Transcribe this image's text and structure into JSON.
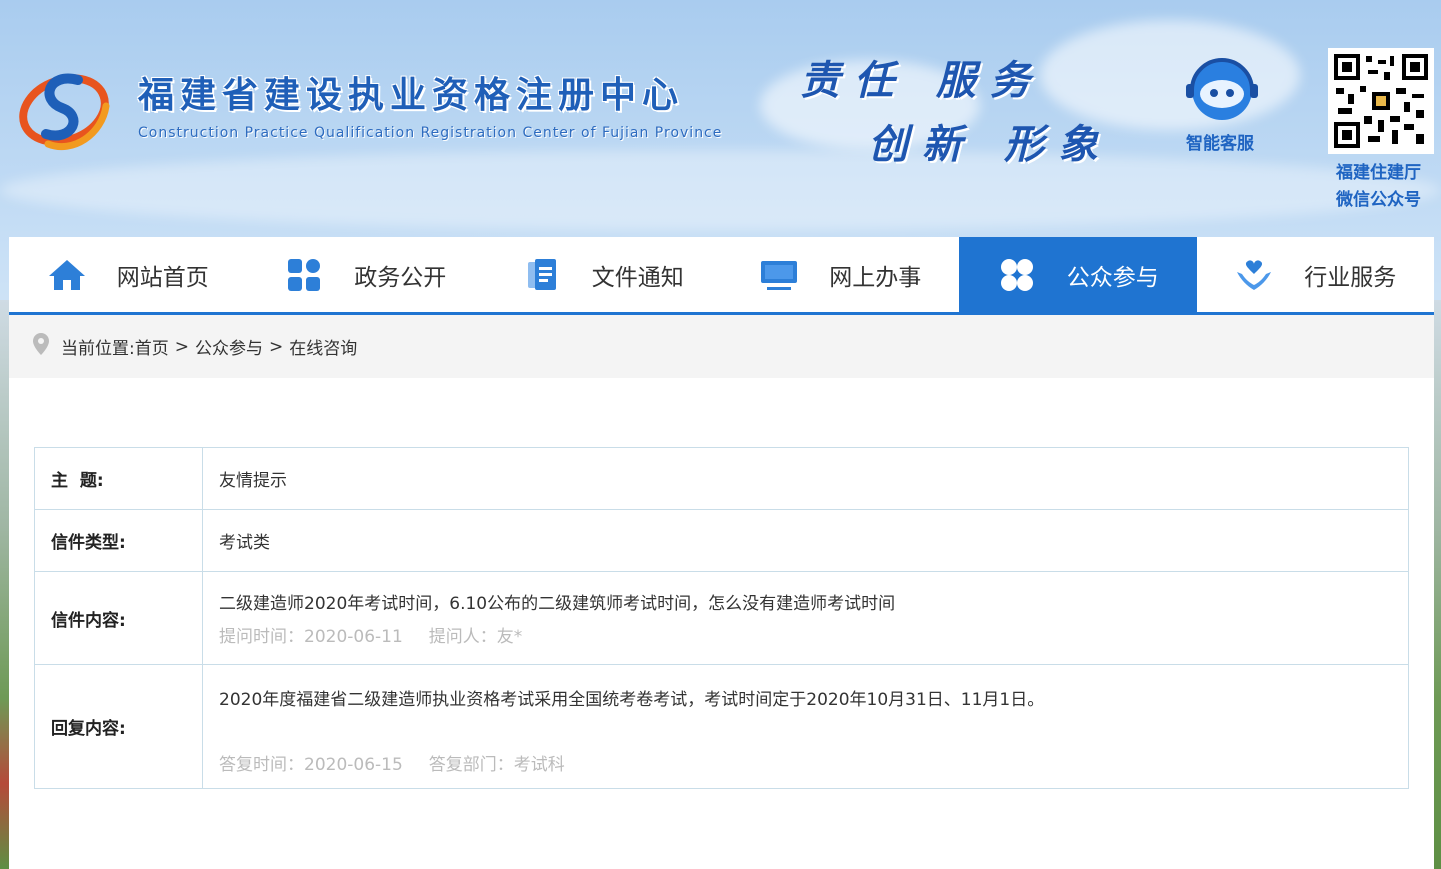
{
  "header": {
    "title": "福建省建设执业资格注册中心",
    "subtitle": "Construction Practice Qualification Registration Center of Fujian Province",
    "slogan_line1": "责任 服务",
    "slogan_line2": "创新 形象",
    "service_label": "智能客服",
    "qr_label_line1": "福建住建厅",
    "qr_label_line2": "微信公众号"
  },
  "nav": {
    "items": [
      {
        "label": "网站首页",
        "icon": "home-icon"
      },
      {
        "label": "政务公开",
        "icon": "grid-icon"
      },
      {
        "label": "文件通知",
        "icon": "document-icon"
      },
      {
        "label": "网上办事",
        "icon": "monitor-icon"
      },
      {
        "label": "公众参与",
        "icon": "clover-icon",
        "active": true
      },
      {
        "label": "行业服务",
        "icon": "hands-heart-icon"
      }
    ]
  },
  "breadcrumb": {
    "prefix": "当前位置:",
    "items": [
      "首页",
      "公众参与",
      "在线咨询"
    ],
    "separator": ">"
  },
  "detail": {
    "subject_label": "主  题:",
    "subject_value": "友情提示",
    "type_label": "信件类型:",
    "type_value": "考试类",
    "content_label": "信件内容:",
    "content_value": "二级建造师2020年考试时间，6.10公布的二级建筑师考试时间，怎么没有建造师考试时间",
    "ask_time": "提问时间：2020-06-11",
    "asker": "提问人：友*",
    "reply_label": "回复内容:",
    "reply_value": "2020年度福建省二级建造师执业资格考试采用全国统考卷考试，考试时间定于2020年10月31日、11月1日。",
    "reply_time": "答复时间：2020-06-15",
    "reply_dept": "答复部门：考试科"
  },
  "colors": {
    "brand_blue": "#1f74d1",
    "title_blue": "#1f5fb8",
    "border": "#c9dde8",
    "meta_gray": "#bbbbbb"
  }
}
